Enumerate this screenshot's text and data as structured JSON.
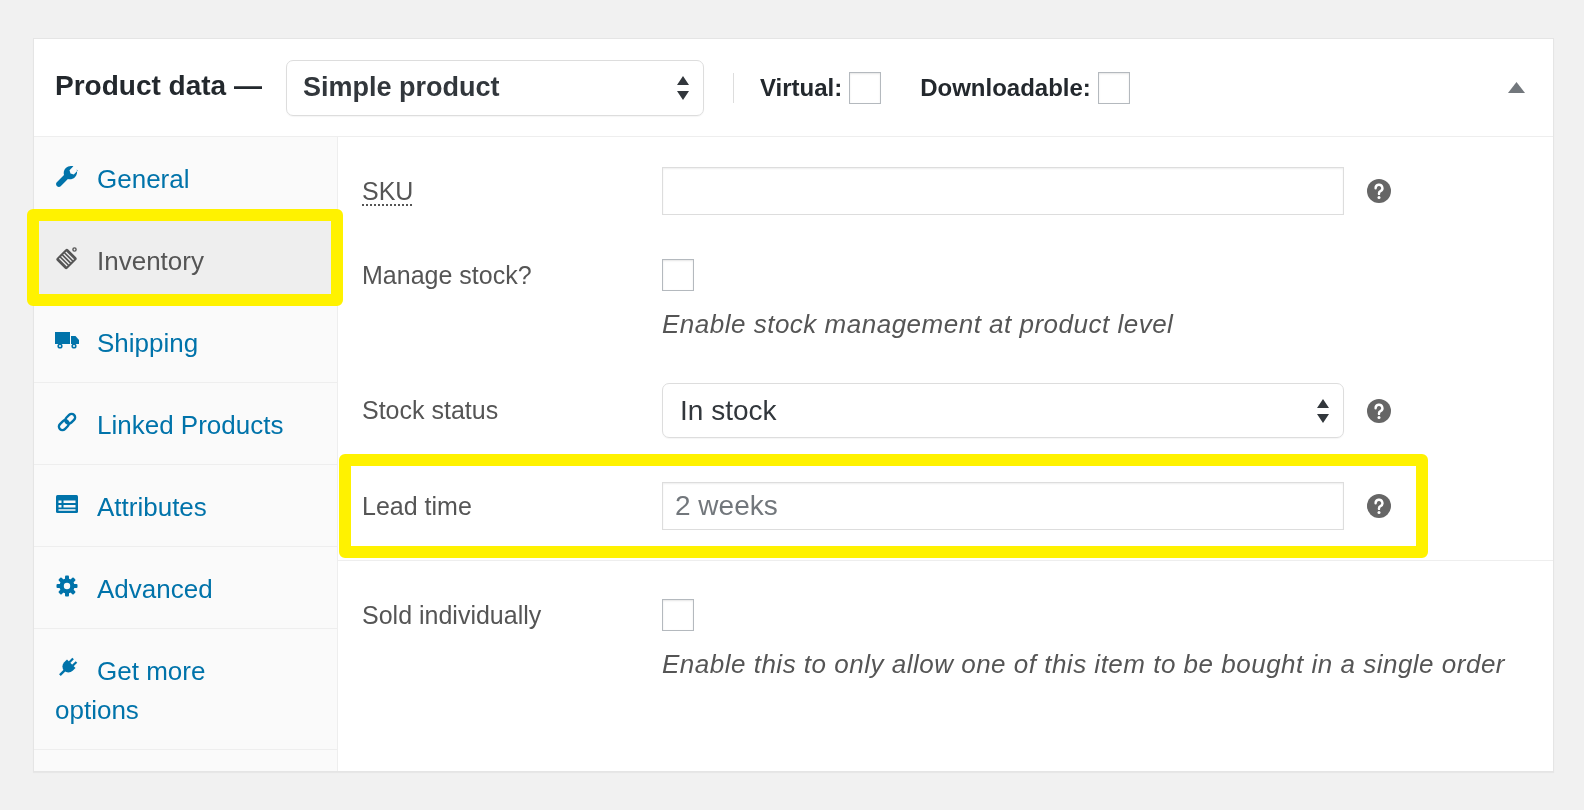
{
  "header": {
    "title": "Product data —",
    "product_type": "Simple product",
    "options": [
      {
        "label": "Virtual:",
        "checked": false
      },
      {
        "label": "Downloadable:",
        "checked": false
      }
    ],
    "expanded": true
  },
  "tabs": [
    {
      "label": "General",
      "selected": false,
      "highlighted": false
    },
    {
      "label": "Inventory",
      "selected": true,
      "highlighted": true
    },
    {
      "label": "Shipping",
      "selected": false,
      "highlighted": false
    },
    {
      "label": "Linked Products",
      "selected": false,
      "highlighted": false
    },
    {
      "label": "Attributes",
      "selected": false,
      "highlighted": false
    },
    {
      "label": "Advanced",
      "selected": false,
      "highlighted": false
    },
    {
      "label": "Get more options",
      "selected": false,
      "highlighted": false
    }
  ],
  "groups": [
    {
      "fields": [
        {
          "kind": "text",
          "label": "SKU",
          "abbreviation": true,
          "help": true,
          "highlighted": false
        },
        {
          "kind": "checkbox",
          "label": "Manage stock?",
          "abbreviation": false,
          "checked": false,
          "description": "Enable stock management at product level",
          "help": false,
          "highlighted": false
        },
        {
          "kind": "select",
          "label": "Stock status",
          "abbreviation": false,
          "value": "In stock",
          "help": true,
          "highlighted": false
        },
        {
          "kind": "text",
          "label": "Lead time",
          "abbreviation": false,
          "placeholder": "2 weeks",
          "help": true,
          "highlighted": true
        }
      ]
    },
    {
      "fields": [
        {
          "kind": "checkbox",
          "label": "Sold individually",
          "abbreviation": false,
          "checked": false,
          "description": "Enable this to only allow one of this item to be bought in a single order",
          "help": false,
          "highlighted": false
        }
      ]
    }
  ]
}
